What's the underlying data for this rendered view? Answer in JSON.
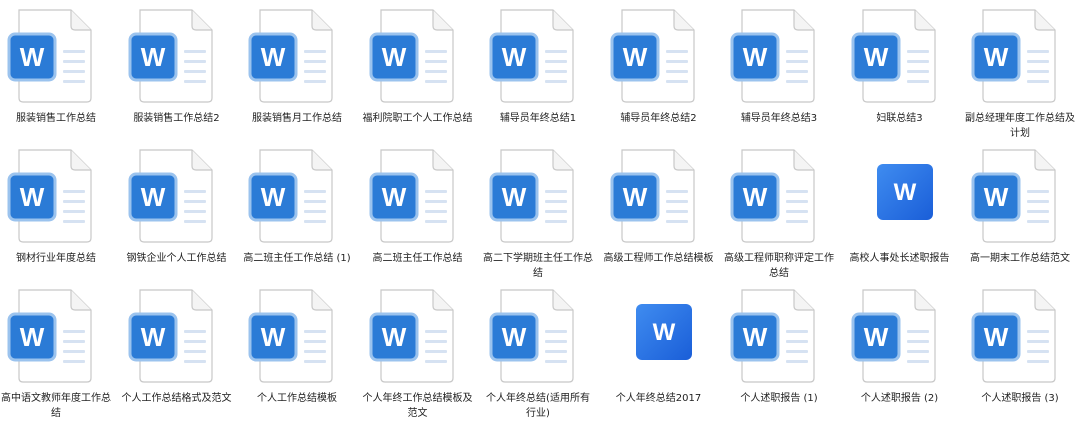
{
  "colors": {
    "page_fold": "#c8c8c8",
    "page_body": "#ffffff",
    "page_lines": "#d6e2f2",
    "badge_blue": "#2b7bd6",
    "badge_border": "#9bc3ee",
    "badge_text": "#ffffff",
    "tile_light": "#3f8cf0",
    "tile_dark": "#1a5ed8",
    "label_text": "#222222"
  },
  "files": [
    {
      "name": "服装销售工作总结",
      "icon": "word-doc-icon"
    },
    {
      "name": "服装销售工作总结2",
      "icon": "word-doc-icon"
    },
    {
      "name": "服装销售月工作总结",
      "icon": "word-doc-icon"
    },
    {
      "name": "福利院职工个人工作总结",
      "icon": "word-doc-icon"
    },
    {
      "name": "辅导员年终总结1",
      "icon": "word-doc-icon"
    },
    {
      "name": "辅导员年终总结2",
      "icon": "word-doc-icon"
    },
    {
      "name": "辅导员年终总结3",
      "icon": "word-doc-icon"
    },
    {
      "name": "妇联总结3",
      "icon": "word-doc-icon"
    },
    {
      "name": "副总经理年度工作总结及计划",
      "icon": "word-doc-icon"
    },
    {
      "name": "钢材行业年度总结",
      "icon": "word-doc-icon"
    },
    {
      "name": "钢铁企业个人工作总结",
      "icon": "word-doc-icon"
    },
    {
      "name": "高二班主任工作总结 (1)",
      "icon": "word-doc-icon"
    },
    {
      "name": "高二班主任工作总结",
      "icon": "word-doc-icon"
    },
    {
      "name": "高二下学期班主任工作总结",
      "icon": "word-doc-icon"
    },
    {
      "name": "高级工程师工作总结模板",
      "icon": "word-doc-icon"
    },
    {
      "name": "高级工程师职称评定工作总结",
      "icon": "word-doc-icon"
    },
    {
      "name": "高校人事处长述职报告",
      "icon": "word-tile-icon"
    },
    {
      "name": "高一期末工作总结范文",
      "icon": "word-doc-icon"
    },
    {
      "name": "高中语文教师年度工作总结",
      "icon": "word-doc-icon"
    },
    {
      "name": "个人工作总结格式及范文",
      "icon": "word-doc-icon"
    },
    {
      "name": "个人工作总结模板",
      "icon": "word-doc-icon"
    },
    {
      "name": "个人年终工作总结模板及范文",
      "icon": "word-doc-icon"
    },
    {
      "name": "个人年终总结(适用所有行业)",
      "icon": "word-doc-icon"
    },
    {
      "name": "个人年终总结2017",
      "icon": "word-tile-icon"
    },
    {
      "name": "个人述职报告 (1)",
      "icon": "word-doc-icon"
    },
    {
      "name": "个人述职报告 (2)",
      "icon": "word-doc-icon"
    },
    {
      "name": "个人述职报告 (3)",
      "icon": "word-doc-icon"
    }
  ]
}
